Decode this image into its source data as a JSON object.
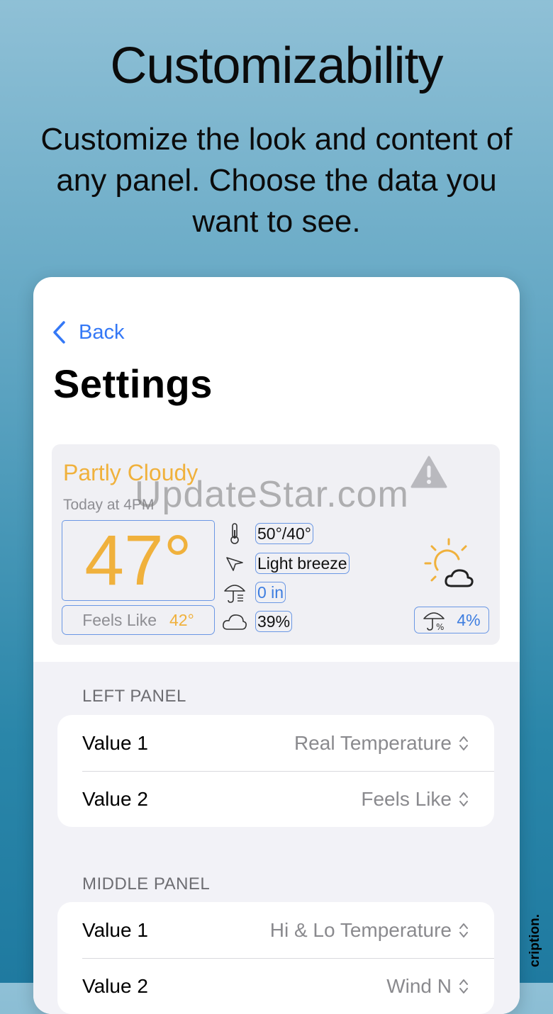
{
  "promo": {
    "headline": "Customizability",
    "subline": "Customize the look and content of any panel. Choose the data you want to see.",
    "side_note": "cription."
  },
  "nav": {
    "back_label": "Back",
    "title": "Settings"
  },
  "widget": {
    "condition": "Partly Cloudy",
    "time": "Today at 4PM",
    "temperature": "47°",
    "feels_label": "Feels Like",
    "feels_value": "42°",
    "hi_lo": "50°/40°",
    "wind": "Light breeze",
    "precip_amount": "0 in",
    "cloud_cover": "39%",
    "precip_chance": "4%",
    "accent_color": "#f0b13c",
    "border_color": "#6a97e4",
    "icons": [
      "alert-triangle-icon",
      "thermometer-icon",
      "wind-arrow-icon",
      "umbrella-icon",
      "cloud-icon",
      "partly-cloudy-icon",
      "umbrella-percent-icon"
    ]
  },
  "watermark": "UpdateStar.com",
  "sections": [
    {
      "header": "LEFT PANEL",
      "rows": [
        {
          "label": "Value 1",
          "value": "Real Temperature"
        },
        {
          "label": "Value 2",
          "value": "Feels Like"
        }
      ]
    },
    {
      "header": "MIDDLE PANEL",
      "rows": [
        {
          "label": "Value 1",
          "value": "Hi & Lo Temperature"
        },
        {
          "label": "Value 2",
          "value": "Wind N"
        }
      ]
    }
  ],
  "colors": {
    "link": "#3478f6",
    "grouped_background": "#f2f2f7"
  }
}
